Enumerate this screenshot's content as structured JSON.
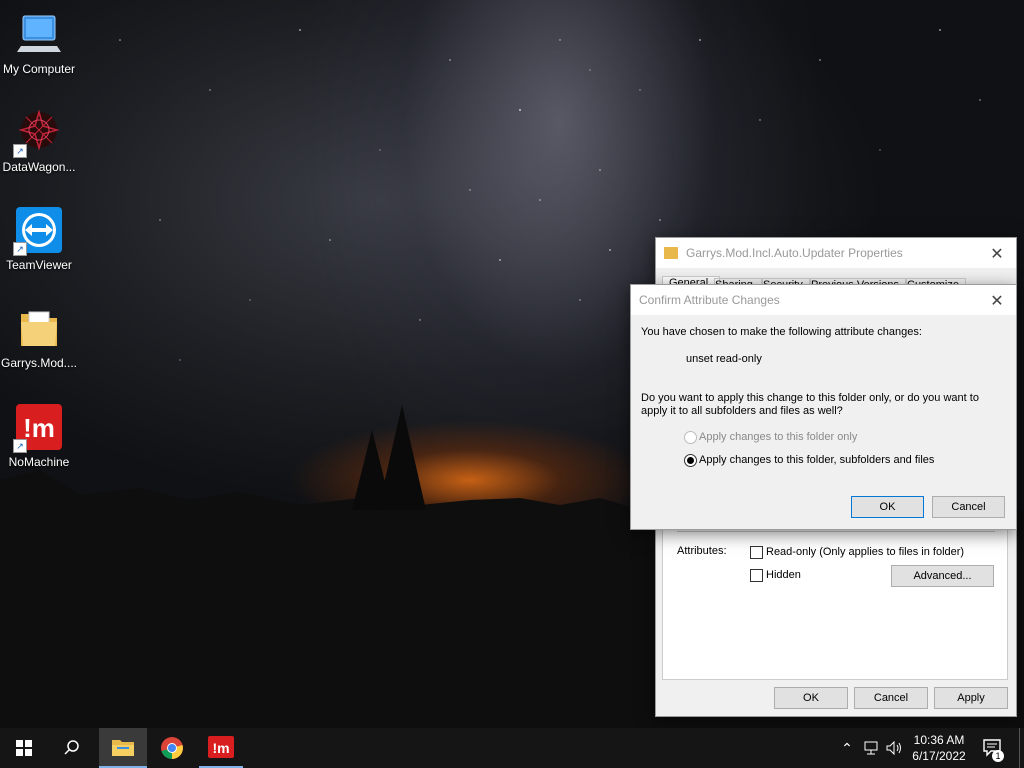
{
  "desktop": {
    "icons": [
      {
        "label": "My Computer",
        "icon": "computer-icon"
      },
      {
        "label": "DataWagon...",
        "icon": "datawagon-icon"
      },
      {
        "label": "TeamViewer",
        "icon": "teamviewer-icon"
      },
      {
        "label": "Garrys.Mod....",
        "icon": "folder-icon"
      },
      {
        "label": "NoMachine",
        "icon": "nomachine-icon"
      }
    ]
  },
  "properties_dialog": {
    "title": "Garrys.Mod.Incl.Auto.Updater Properties",
    "tabs": [
      "General",
      "Sharing",
      "Security",
      "Previous Versions",
      "Customize"
    ],
    "attributes_label": "Attributes:",
    "readonly_label": "Read-only (Only applies to files in folder)",
    "readonly_checked": false,
    "hidden_label": "Hidden",
    "hidden_checked": false,
    "advanced_button": "Advanced...",
    "ok_button": "OK",
    "cancel_button": "Cancel",
    "apply_button": "Apply"
  },
  "confirm_dialog": {
    "title": "Confirm Attribute Changes",
    "intro": "You have chosen to make the following attribute changes:",
    "change": "unset read-only",
    "question_line1": "Do you want to apply this change to this folder only, or do you want to",
    "question_line2": "apply it to all subfolders and files as well?",
    "option_folder_only": "Apply changes to this folder only",
    "option_all": "Apply changes to this folder, subfolders and files",
    "selected_option": "option_all",
    "ok_button": "OK",
    "cancel_button": "Cancel"
  },
  "taskbar": {
    "time": "10:36 AM",
    "date": "6/17/2022",
    "notification_count": "1",
    "pinned": [
      "file-explorer-icon",
      "chrome-icon",
      "nomachine-icon"
    ]
  }
}
